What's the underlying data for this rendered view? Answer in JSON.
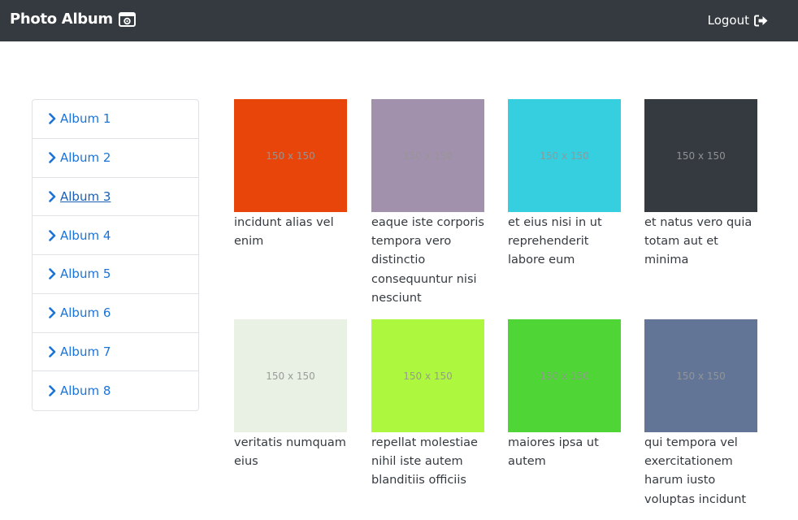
{
  "navbar": {
    "brand": "Photo Album",
    "brand_icon": "photo-album-icon",
    "logout_label": "Logout",
    "logout_icon": "logout-icon"
  },
  "sidebar": {
    "items": [
      {
        "label": "Album 1",
        "active": false
      },
      {
        "label": "Album 2",
        "active": false
      },
      {
        "label": "Album 3",
        "active": true
      },
      {
        "label": "Album 4",
        "active": false
      },
      {
        "label": "Album 5",
        "active": false
      },
      {
        "label": "Album 6",
        "active": false
      },
      {
        "label": "Album 7",
        "active": false
      },
      {
        "label": "Album 8",
        "active": false
      }
    ]
  },
  "photos": [
    {
      "placeholder": "150 x 150",
      "color": "#e8450b",
      "title": "incidunt alias vel enim"
    },
    {
      "placeholder": "150 x 150",
      "color": "#a291ad",
      "title": "eaque iste corporis tempora vero distinctio consequuntur nisi nesciunt"
    },
    {
      "placeholder": "150 x 150",
      "color": "#35cfe0",
      "title": "et eius nisi in ut reprehenderit labore eum"
    },
    {
      "placeholder": "150 x 150",
      "color": "#343a40",
      "title": "et natus vero quia totam aut et minima"
    },
    {
      "placeholder": "150 x 150",
      "color": "#e9f1e4",
      "title": "veritatis numquam eius"
    },
    {
      "placeholder": "150 x 150",
      "color": "#adf83f",
      "title": "repellat molestiae nihil iste autem blanditiis officiis"
    },
    {
      "placeholder": "150 x 150",
      "color": "#4fd535",
      "title": "maiores ipsa ut autem"
    },
    {
      "placeholder": "150 x 150",
      "color": "#627596",
      "title": "qui tempora vel exercitationem harum iusto voluptas incidunt"
    }
  ]
}
